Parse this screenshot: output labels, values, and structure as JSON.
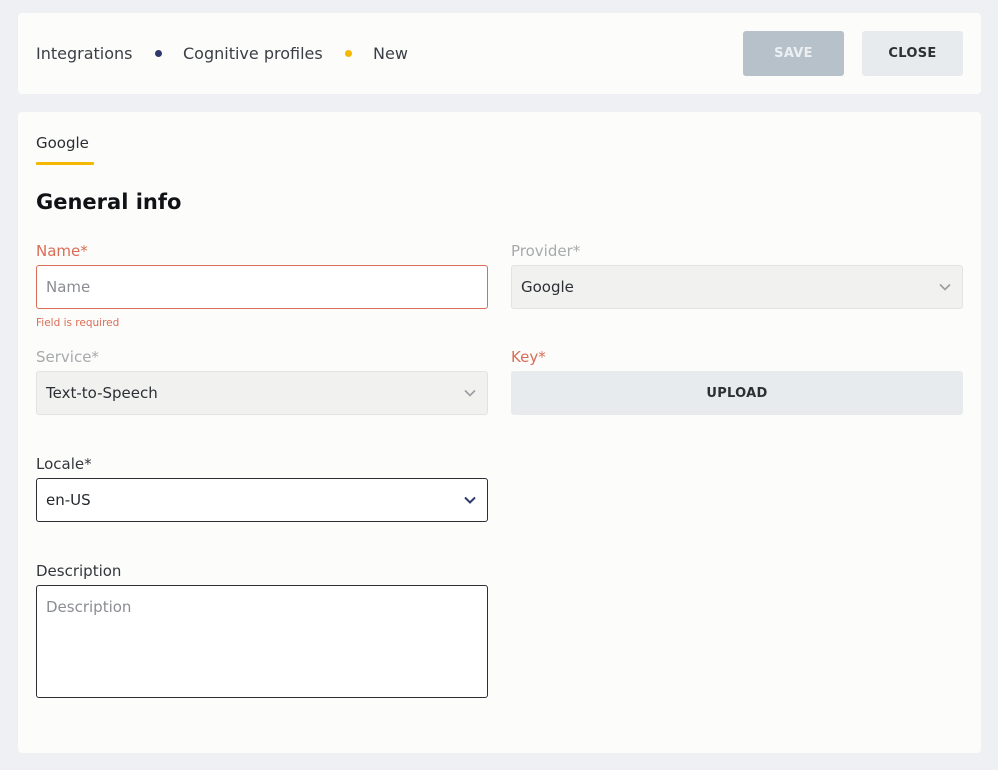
{
  "breadcrumb": {
    "items": [
      "Integrations",
      "Cognitive profiles",
      "New"
    ],
    "dot_colors": [
      "#2f3a6b",
      "#f5b800"
    ]
  },
  "toolbar": {
    "save_label": "SAVE",
    "close_label": "CLOSE"
  },
  "tabs": [
    {
      "label": "Google",
      "active": true
    }
  ],
  "section_title": "General info",
  "form": {
    "name": {
      "label": "Name*",
      "placeholder": "Name",
      "value": "",
      "error": "Field is required"
    },
    "provider": {
      "label": "Provider*",
      "value": "Google",
      "icon": "chevron-down-icon"
    },
    "service": {
      "label": "Service*",
      "value": "Text-to-Speech",
      "icon": "chevron-down-icon"
    },
    "key": {
      "label": "Key*",
      "button_label": "UPLOAD"
    },
    "locale": {
      "label": "Locale*",
      "value": "en-US",
      "icon": "chevron-down-icon"
    },
    "description": {
      "label": "Description",
      "placeholder": "Description",
      "value": ""
    }
  },
  "colors": {
    "accent": "#f5b800",
    "error": "#d96d57",
    "save_disabled": "#b6c1ca",
    "chevron_active": "#2f3a6b"
  }
}
